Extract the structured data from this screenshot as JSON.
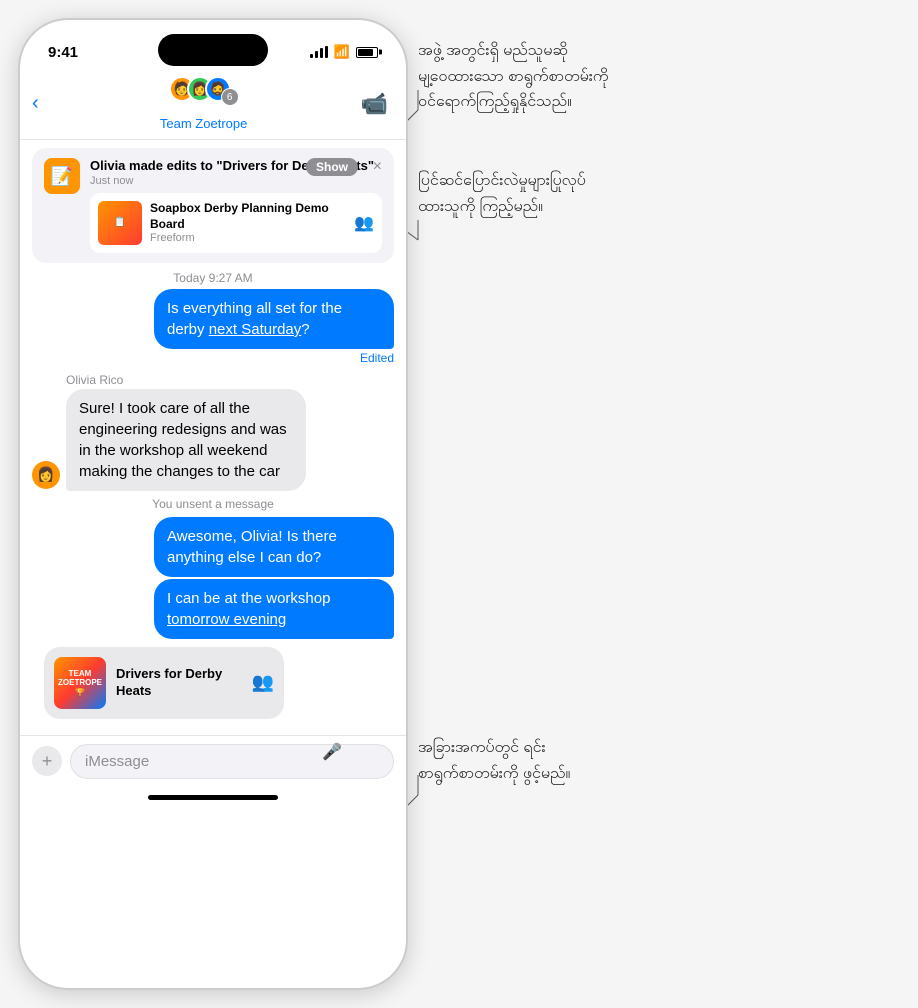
{
  "status_bar": {
    "time": "9:41",
    "signal": "signal",
    "wifi": "wifi",
    "battery": "battery"
  },
  "header": {
    "back_label": "‹",
    "group_name": "Team Zoetrope",
    "video_call_icon": "📹"
  },
  "notification": {
    "title": "Olivia made edits to \"Drivers for Derby Heats\"",
    "time": "Just now",
    "show_label": "Show",
    "close_icon": "×",
    "card_title": "Soapbox Derby Planning Demo Board",
    "card_source": "Freeform",
    "card_icon": "👥"
  },
  "messages": {
    "timestamp_1": "Today 9:27 AM",
    "sent_1": "Is everything all set for the derby next Saturday?",
    "sent_1_link": "next Saturday",
    "edited_label": "Edited",
    "sender_name": "Olivia Rico",
    "received_1": "Sure! I took care of all the engineering redesigns and was in the workshop all weekend making the changes to the car",
    "system_msg": "You unsent a message",
    "sent_2": "Awesome, Olivia! Is there anything else I can do?",
    "sent_3": "I can be at the workshop tomorrow evening",
    "sent_3_link": "tomorrow evening",
    "card_title": "Drivers for Derby Heats",
    "card_icon": "👥"
  },
  "input_bar": {
    "placeholder": "iMessage",
    "plus_icon": "+",
    "mic_icon": "🎤"
  },
  "annotations": {
    "annot1_line1": "အဖွဲ့ အတွင်းရှိ မည်သူမဆို",
    "annot1_line2": "မျ့ဝေထားသော စာရွက်စာတမ်းကို",
    "annot1_line3": "ဝင်ရောက်ကြည့်ရှုနိုင်သည်။",
    "annot2_line1": "ပြင်ဆင်ပြောင်းလဲမှုများပြုလုပ်",
    "annot2_line2": "ထားသူကို ကြည့်မည်။",
    "annot3_line1": "အခြားအကပ်တွင် ရင်း",
    "annot3_line2": "စာရွက်စာတမ်းကို ဖွင့်မည်။"
  }
}
